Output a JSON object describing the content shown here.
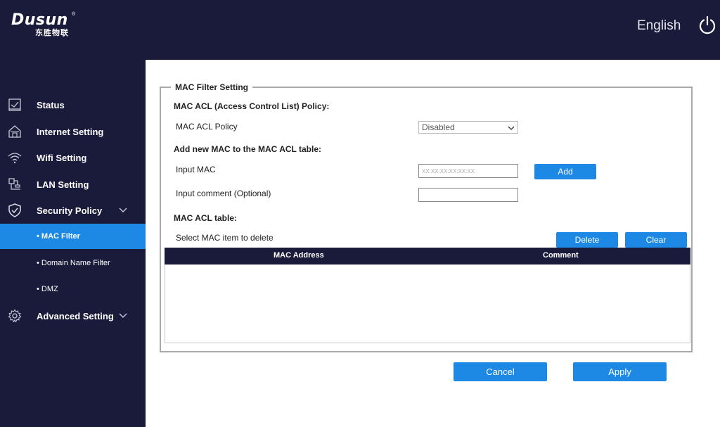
{
  "header": {
    "brand": "Dusun",
    "brand_mark": "®",
    "brand_sub": "东胜物联",
    "language": "English",
    "power_icon": "power-icon"
  },
  "sidebar": {
    "items": [
      {
        "label": "Status",
        "icon": "status-check-icon"
      },
      {
        "label": "Internet Setting",
        "icon": "house-icon"
      },
      {
        "label": "Wifi Setting",
        "icon": "wifi-icon"
      },
      {
        "label": "LAN Setting",
        "icon": "lan-icon"
      },
      {
        "label": "Security Policy",
        "icon": "shield-icon",
        "expanded": true
      },
      {
        "label": "• MAC Filter",
        "active": true
      },
      {
        "label": "• Domain Name Filter"
      },
      {
        "label": "• DMZ"
      },
      {
        "label": "Advanced Setting",
        "icon": "gear-icon"
      }
    ]
  },
  "form": {
    "legend": "MAC Filter Setting",
    "policy_heading": "MAC ACL (Access Control List) Policy:",
    "policy_label": "MAC ACL Policy",
    "policy_value": "Disabled",
    "add_heading": "Add new MAC to the MAC ACL table:",
    "input_mac_label": "Input MAC",
    "input_mac_placeholder": "XX:XX:XX:XX:XX:XX",
    "add_button": "Add",
    "comment_label": "Input comment (Optional)",
    "comment_value": "",
    "table_heading": "MAC ACL table:",
    "select_label": "Select MAC item to delete",
    "delete_button": "Delete",
    "clear_button": "Clear",
    "columns": [
      "MAC Address",
      "Comment"
    ],
    "rows": []
  },
  "footer": {
    "cancel": "Cancel",
    "apply": "Apply"
  },
  "colors": {
    "nav_bg": "#1a1a3a",
    "accent": "#1e88e5"
  }
}
